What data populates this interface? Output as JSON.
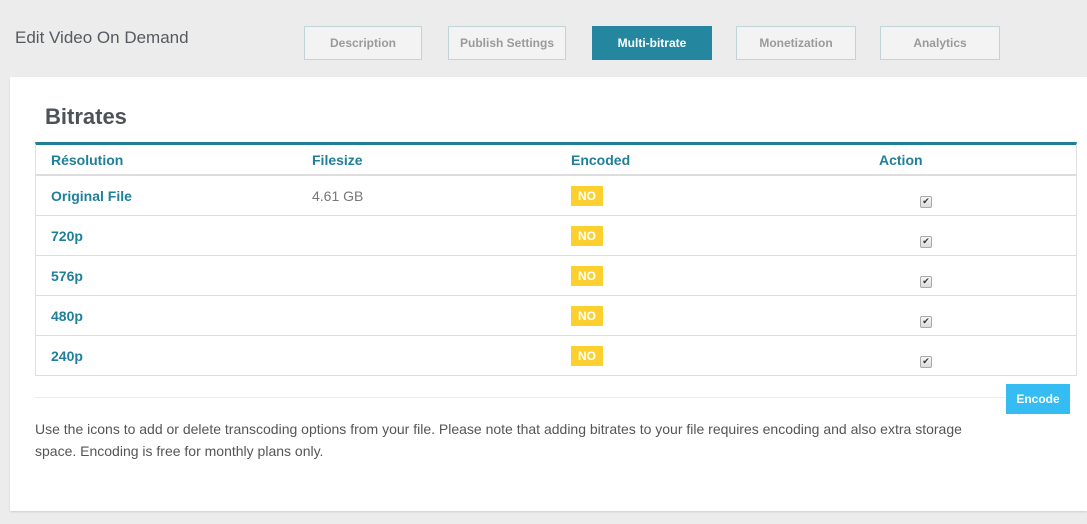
{
  "page": {
    "title": "Edit Video On Demand"
  },
  "tabs": [
    {
      "label": "Description",
      "active": false
    },
    {
      "label": "Publish Settings",
      "active": false
    },
    {
      "label": "Multi-bitrate",
      "active": true
    },
    {
      "label": "Monetization",
      "active": false
    },
    {
      "label": "Analytics",
      "active": false
    }
  ],
  "section": {
    "title": "Bitrates"
  },
  "table": {
    "headers": [
      "Résolution",
      "Filesize",
      "Encoded",
      "Action"
    ],
    "rows": [
      {
        "resolution": "Original File",
        "filesize": "4.61 GB",
        "encoded": "NO",
        "action_checked": true
      },
      {
        "resolution": "720p",
        "filesize": "",
        "encoded": "NO",
        "action_checked": true
      },
      {
        "resolution": "576p",
        "filesize": "",
        "encoded": "NO",
        "action_checked": true
      },
      {
        "resolution": "480p",
        "filesize": "",
        "encoded": "NO",
        "action_checked": true
      },
      {
        "resolution": "240p",
        "filesize": "",
        "encoded": "NO",
        "action_checked": true
      }
    ]
  },
  "actions": {
    "encode_label": "Encode",
    "checkbox_glyph": "✔"
  },
  "note": "Use the icons to add or delete transcoding options from your file. Please note that adding bitrates to your file requires encoding and also extra storage space. Encoding is free for monthly plans only.",
  "colors": {
    "accent": "#1f7f9b",
    "active_tab": "#24869f",
    "badge_no": "#fcd12f",
    "encode_button": "#35bcf2"
  }
}
